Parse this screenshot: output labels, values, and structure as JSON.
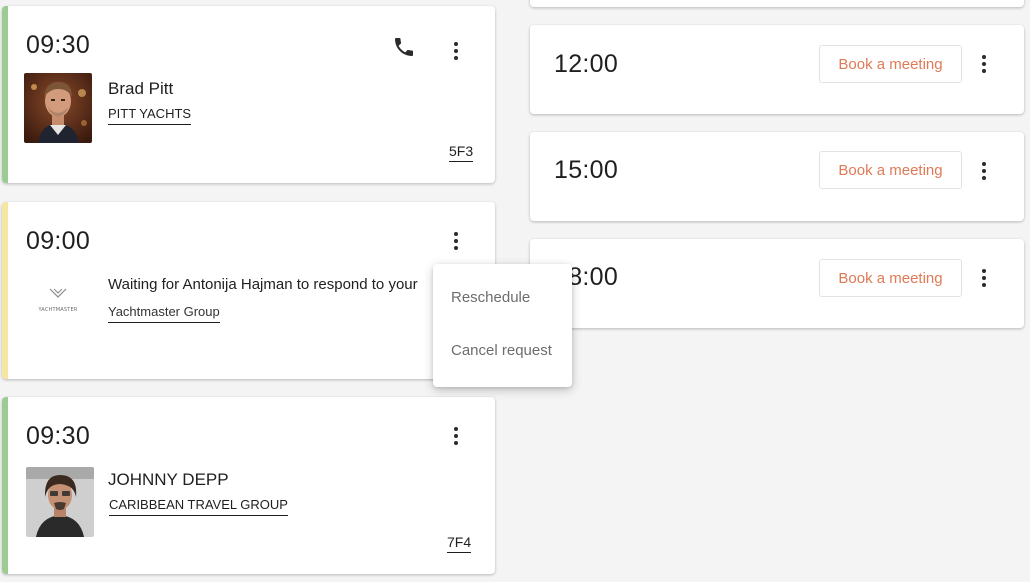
{
  "colors": {
    "accent_green": "#9ccc92",
    "accent_yellow": "#f6e6a0",
    "book_button_text": "#e07a56"
  },
  "left_cards": [
    {
      "time": "09:30",
      "status": "confirmed",
      "has_phone_icon": true,
      "name": "Brad Pitt",
      "company": "PITT YACHTS",
      "code": "5F3",
      "icons": {
        "phone": "phone-icon",
        "more": "more-vert-icon"
      }
    },
    {
      "time": "09:00",
      "status": "pending",
      "message_prefix": "Waiting for ",
      "message_person": "Antonija Hajman",
      "message_suffix": " to respond to your",
      "company": "Yachtmaster Group",
      "logo_label": "YACHTMASTER",
      "icons": {
        "more": "more-vert-icon"
      }
    },
    {
      "time": "09:30",
      "status": "confirmed",
      "name": "JOHNNY DEPP",
      "company": "CARIBBEAN TRAVEL GROUP",
      "code": "7F4",
      "icons": {
        "more": "more-vert-icon"
      }
    }
  ],
  "right_slots": [
    {
      "time": "12:00",
      "button_label": "Book a meeting"
    },
    {
      "time": "15:00",
      "button_label": "Book a meeting"
    },
    {
      "time": "18:00",
      "button_label": "Book a meeting"
    }
  ],
  "context_menu": {
    "items": [
      "Reschedule",
      "Cancel request"
    ]
  }
}
